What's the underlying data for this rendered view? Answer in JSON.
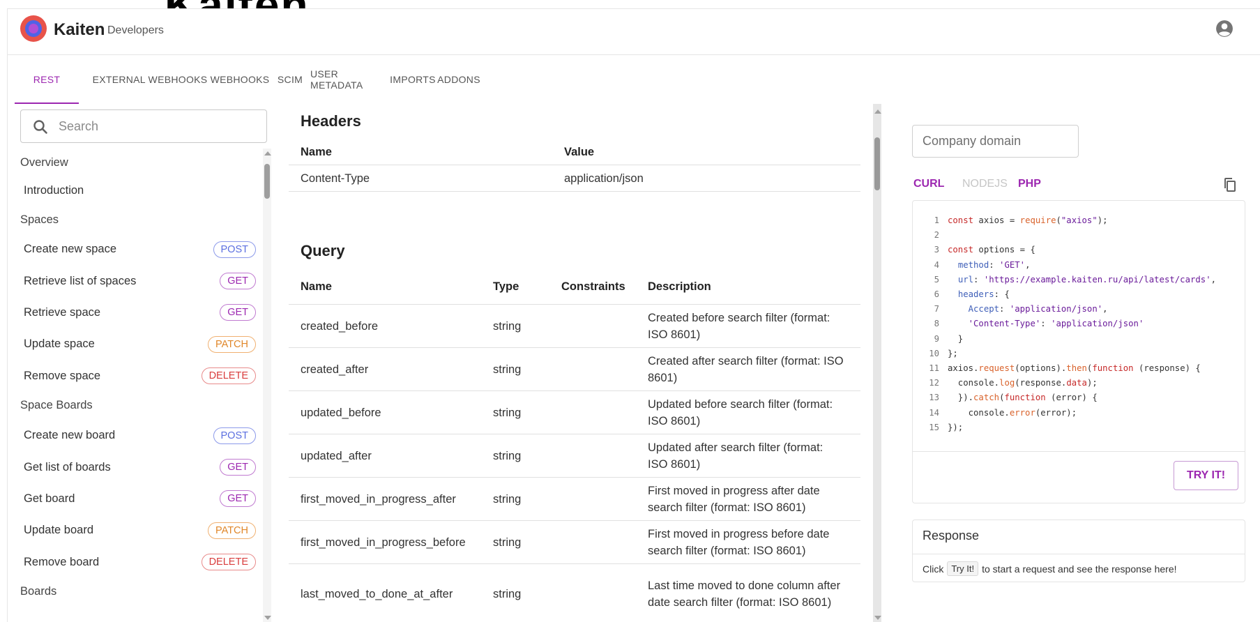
{
  "bg_logo_text": "Kaiten",
  "header": {
    "brand": "Kaiten",
    "subtitle": "Developers"
  },
  "tabs": [
    {
      "label": "REST",
      "active": true
    },
    {
      "label": "EXTERNAL WEBHOOKS"
    },
    {
      "label": "WEBHOOKS"
    },
    {
      "label": "SCIM"
    },
    {
      "label": "USER METADATA"
    },
    {
      "label": "IMPORTS"
    },
    {
      "label": "ADDONS"
    }
  ],
  "colors": {
    "accent": "#9c27b0",
    "post": "#5b6fe0",
    "get": "#9c27b0",
    "patch": "#e0872a",
    "delete": "#d93d3d"
  },
  "sidebar": {
    "search_placeholder": "Search",
    "sections": [
      {
        "title": "Overview",
        "items": [
          {
            "label": "Introduction"
          }
        ]
      },
      {
        "title": "Spaces",
        "items": [
          {
            "label": "Create new space",
            "method": "POST"
          },
          {
            "label": "Retrieve list of spaces",
            "method": "GET"
          },
          {
            "label": "Retrieve space",
            "method": "GET"
          },
          {
            "label": "Update space",
            "method": "PATCH"
          },
          {
            "label": "Remove space",
            "method": "DELETE"
          }
        ]
      },
      {
        "title": "Space Boards",
        "items": [
          {
            "label": "Create new board",
            "method": "POST"
          },
          {
            "label": "Get list of boards",
            "method": "GET"
          },
          {
            "label": "Get board",
            "method": "GET"
          },
          {
            "label": "Update board",
            "method": "PATCH"
          },
          {
            "label": "Remove board",
            "method": "DELETE"
          }
        ]
      },
      {
        "title": "Boards",
        "items": []
      }
    ]
  },
  "main": {
    "headers_title": "Headers",
    "headers_table": {
      "columns": [
        "Name",
        "Value"
      ],
      "rows": [
        [
          "Content-Type",
          "application/json"
        ]
      ]
    },
    "query_title": "Query",
    "query_table": {
      "columns": [
        "Name",
        "Type",
        "Constraints",
        "Description"
      ],
      "rows": [
        [
          "created_before",
          "string",
          "",
          "Created before search filter (format: ISO 8601)"
        ],
        [
          "created_after",
          "string",
          "",
          "Created after search filter (format: ISO 8601)"
        ],
        [
          "updated_before",
          "string",
          "",
          "Updated before search filter (format: ISO 8601)"
        ],
        [
          "updated_after",
          "string",
          "",
          "Updated after search filter (format: ISO 8601)"
        ],
        [
          "first_moved_in_progress_after",
          "string",
          "",
          "First moved in progress after date search filter (format: ISO 8601)"
        ],
        [
          "first_moved_in_progress_before",
          "string",
          "",
          "First moved in progress before date search filter (format: ISO 8601)"
        ],
        [
          "last_moved_to_done_at_after",
          "string",
          "",
          "Last time moved to done column after date search filter (format: ISO 8601)"
        ]
      ]
    }
  },
  "right": {
    "domain_placeholder": "Company domain",
    "langs": [
      {
        "label": "CURL",
        "state": "active"
      },
      {
        "label": "NODEJS",
        "state": "disabled"
      },
      {
        "label": "PHP",
        "state": "normal"
      }
    ],
    "code_lines": [
      "const axios = require(\"axios\");",
      "",
      "const options = {",
      "  method: 'GET',",
      "  url: 'https://example.kaiten.ru/api/latest/cards',",
      "  headers: {",
      "    Accept: 'application/json',",
      "    'Content-Type': 'application/json'",
      "  }",
      "};",
      "axios.request(options).then(function (response) {",
      "  console.log(response.data);",
      "  }).catch(function (error) {",
      "    console.error(error);",
      "});"
    ],
    "try_button": "TRY IT!",
    "response_title": "Response",
    "response_text_before": "Click",
    "response_kbd": "Try It!",
    "response_text_after": "to start a request and see the response here!"
  }
}
